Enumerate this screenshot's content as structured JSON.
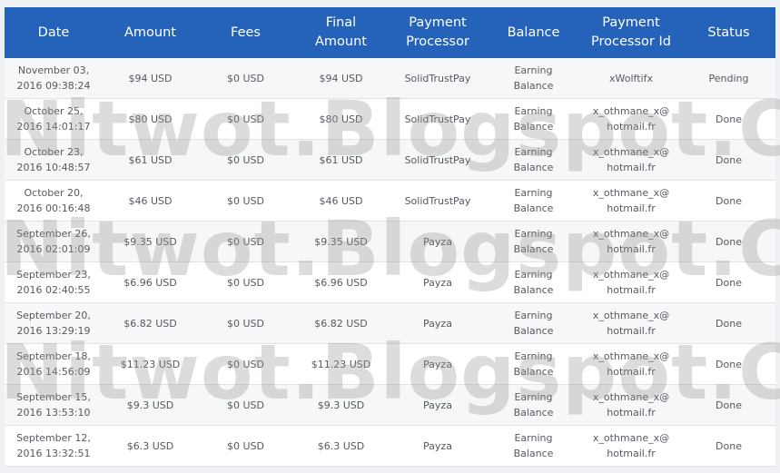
{
  "table": {
    "headers": {
      "date": "Date",
      "amount": "Amount",
      "fees": "Fees",
      "final_amount_line1": "Final",
      "final_amount_line2": "Amount",
      "processor_line1": "Payment",
      "processor_line2": "Processor",
      "balance": "Balance",
      "processor_id_line1": "Payment",
      "processor_id_line2": "Processor Id",
      "status": "Status"
    },
    "rows": [
      {
        "date_line1": "November 03,",
        "date_line2": "2016 09:38:24",
        "amount": "$94 USD",
        "fees": "$0 USD",
        "final_amount": "$94 USD",
        "processor": "SolidTrustPay",
        "balance_line1": "Earning",
        "balance_line2": "Balance",
        "processor_id_line1": "xWolftifx",
        "processor_id_line2": "",
        "status": "Pending"
      },
      {
        "date_line1": "October 25,",
        "date_line2": "2016 14:01:17",
        "amount": "$80 USD",
        "fees": "$0 USD",
        "final_amount": "$80 USD",
        "processor": "SolidTrustPay",
        "balance_line1": "Earning",
        "balance_line2": "Balance",
        "processor_id_line1": "x_othmane_x@",
        "processor_id_line2": "hotmail.fr",
        "status": "Done"
      },
      {
        "date_line1": "October 23,",
        "date_line2": "2016 10:48:57",
        "amount": "$61 USD",
        "fees": "$0 USD",
        "final_amount": "$61 USD",
        "processor": "SolidTrustPay",
        "balance_line1": "Earning",
        "balance_line2": "Balance",
        "processor_id_line1": "x_othmane_x@",
        "processor_id_line2": "hotmail.fr",
        "status": "Done"
      },
      {
        "date_line1": "October 20,",
        "date_line2": "2016 00:16:48",
        "amount": "$46 USD",
        "fees": "$0 USD",
        "final_amount": "$46 USD",
        "processor": "SolidTrustPay",
        "balance_line1": "Earning",
        "balance_line2": "Balance",
        "processor_id_line1": "x_othmane_x@",
        "processor_id_line2": "hotmail.fr",
        "status": "Done"
      },
      {
        "date_line1": "September 26,",
        "date_line2": "2016 02:01:09",
        "amount": "$9.35 USD",
        "fees": "$0 USD",
        "final_amount": "$9.35 USD",
        "processor": "Payza",
        "balance_line1": "Earning",
        "balance_line2": "Balance",
        "processor_id_line1": "x_othmane_x@",
        "processor_id_line2": "hotmail.fr",
        "status": "Done"
      },
      {
        "date_line1": "September 23,",
        "date_line2": "2016 02:40:55",
        "amount": "$6.96 USD",
        "fees": "$0 USD",
        "final_amount": "$6.96 USD",
        "processor": "Payza",
        "balance_line1": "Earning",
        "balance_line2": "Balance",
        "processor_id_line1": "x_othmane_x@",
        "processor_id_line2": "hotmail.fr",
        "status": "Done"
      },
      {
        "date_line1": "September 20,",
        "date_line2": "2016 13:29:19",
        "amount": "$6.82 USD",
        "fees": "$0 USD",
        "final_amount": "$6.82 USD",
        "processor": "Payza",
        "balance_line1": "Earning",
        "balance_line2": "Balance",
        "processor_id_line1": "x_othmane_x@",
        "processor_id_line2": "hotmail.fr",
        "status": "Done"
      },
      {
        "date_line1": "September 18,",
        "date_line2": "2016 14:56:09",
        "amount": "$11.23 USD",
        "fees": "$0 USD",
        "final_amount": "$11.23 USD",
        "processor": "Payza",
        "balance_line1": "Earning",
        "balance_line2": "Balance",
        "processor_id_line1": "x_othmane_x@",
        "processor_id_line2": "hotmail.fr",
        "status": "Done"
      },
      {
        "date_line1": "September 15,",
        "date_line2": "2016 13:53:10",
        "amount": "$9.3 USD",
        "fees": "$0 USD",
        "final_amount": "$9.3 USD",
        "processor": "Payza",
        "balance_line1": "Earning",
        "balance_line2": "Balance",
        "processor_id_line1": "x_othmane_x@",
        "processor_id_line2": "hotmail.fr",
        "status": "Done"
      },
      {
        "date_line1": "September 12,",
        "date_line2": "2016 13:32:51",
        "amount": "$6.3 USD",
        "fees": "$0 USD",
        "final_amount": "$6.3 USD",
        "processor": "Payza",
        "balance_line1": "Earning",
        "balance_line2": "Balance",
        "processor_id_line1": "x_othmane_x@",
        "processor_id_line2": "hotmail.fr",
        "status": "Done"
      }
    ]
  },
  "watermark": {
    "text": "Nitwot.Blogspot.Com"
  },
  "colors": {
    "header_bg": "#2463b9",
    "header_text": "#ffffff",
    "row_text": "#555a60"
  }
}
